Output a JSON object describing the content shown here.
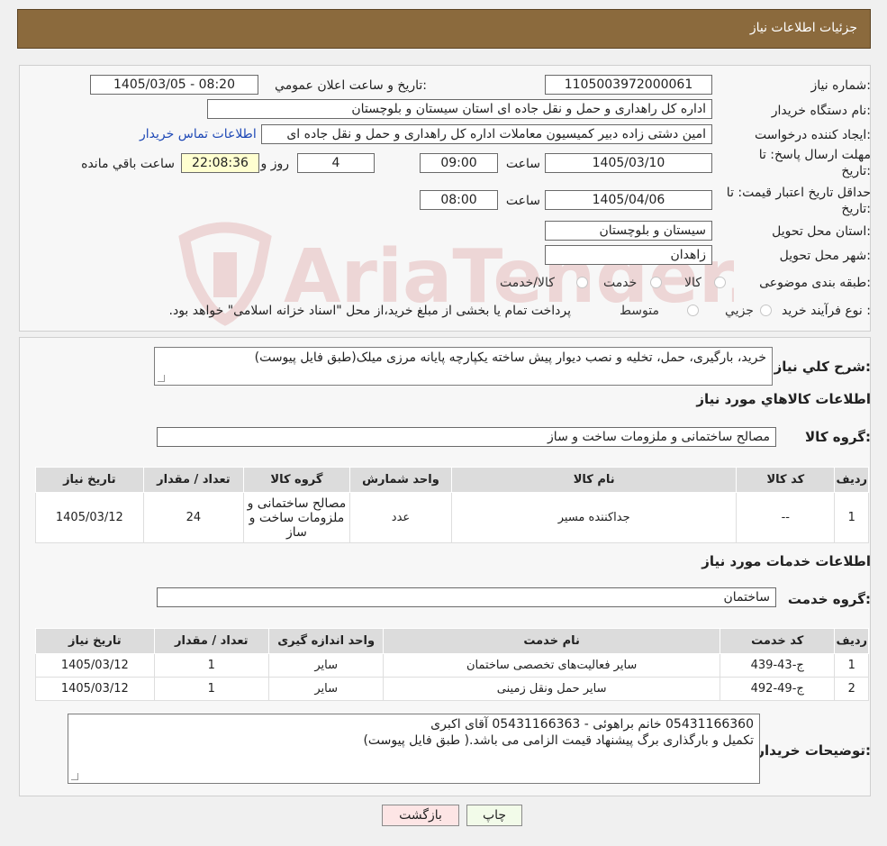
{
  "header": {
    "title": "جزئیات اطلاعات نیاز"
  },
  "watermark": {
    "text": "AriaTender.neT"
  },
  "form": {
    "need_number_label": "شماره نیاز:",
    "need_number": "1105003972000061",
    "announce_label": "تاریخ و ساعت اعلان عمومي:",
    "announce_value": "1405/03/05 - 08:20",
    "buyer_label": "نام دستگاه خريدار:",
    "buyer_value": "اداره کل راهداری و حمل و نقل جاده ای استان سیستان و بلوچستان",
    "creator_label": "ايجاد کننده درخواست:",
    "creator_value": "امین دشتی زاده دبیر کمیسیون معاملات اداره کل راهداری و حمل و نقل جاده ای",
    "contact_link": "اطلاعات تماس خریدار",
    "deadline_label_1": "مهلت ارسال پاسخ: تا",
    "deadline_label_2": "تاریخ:",
    "deadline_date": "1405/03/10",
    "time_label": "ساعت",
    "deadline_time": "09:00",
    "days_value": "4",
    "days_label": "روز و",
    "remaining_time": "22:08:36",
    "remaining_label": "ساعت باقي مانده",
    "validity_label_1": "حداقل تاريخ اعتبار قيمت: تا",
    "validity_label_2": "تاريخ:",
    "validity_date": "1405/04/06",
    "validity_time": "08:00",
    "province_label": "استان محل تحويل:",
    "province_value": "سیستان و بلوچستان",
    "city_label": "شهر محل تحويل:",
    "city_value": "زاهدان",
    "category_label": "طبقه بندی موضوعی:",
    "category_options": [
      "کالا",
      "خدمت",
      "کالا/خدمت"
    ],
    "process_label": "نوع فرآيند خريد :",
    "process_options": [
      "جزيي",
      "متوسط"
    ],
    "process_note": "پرداخت تمام یا بخشی از مبلغ خرید،از محل \"اسناد خزانه اسلامی\" خواهد بود."
  },
  "summary": {
    "label": "شرح كلي نياز:",
    "value": "خرید، بارگیری، حمل، تخلیه و نصب دیوار پیش ساخته یکپارچه پایانه مرزی میلک(طبق فایل پیوست)"
  },
  "goods": {
    "section_title": "اطلاعات کالاهاي مورد نياز",
    "group_label": "گروه کالا:",
    "group_value": "مصالح ساختمانی و ملزومات ساخت و ساز",
    "columns": [
      "رديف",
      "کد کالا",
      "نام کالا",
      "واحد شمارش",
      "گروه کالا",
      "تعداد / مقدار",
      "تاريخ نياز"
    ],
    "rows": [
      [
        "1",
        "--",
        "جداکننده مسیر",
        "عدد",
        "مصالح ساختمانی و ملزومات ساخت و ساز",
        "24",
        "1405/03/12"
      ]
    ]
  },
  "services": {
    "section_title": "اطلاعات خدمات مورد نياز",
    "group_label": "گروه خدمت:",
    "group_value": "ساختمان",
    "columns": [
      "رديف",
      "کد خدمت",
      "نام خدمت",
      "واحد اندازه گيری",
      "تعداد / مقدار",
      "تاريخ نياز"
    ],
    "rows": [
      [
        "1",
        "ج-43-439",
        "سایر فعالیت‌های تخصصی ساختمان",
        "سایر",
        "1",
        "1405/03/12"
      ],
      [
        "2",
        "ج-49-492",
        "سایر حمل ونقل زمینی",
        "سایر",
        "1",
        "1405/03/12"
      ]
    ]
  },
  "buyer_notes": {
    "label": "توضيحات خريدار:",
    "line1": "05431166360 خانم براهوئی - 05431166363 آقای اکبری",
    "line2": "تکمیل و بارگذاری برگ پیشنهاد قیمت الزامی می باشد.( طبق فایل پیوست)"
  },
  "buttons": {
    "print": "چاپ",
    "back": "بازگشت"
  }
}
